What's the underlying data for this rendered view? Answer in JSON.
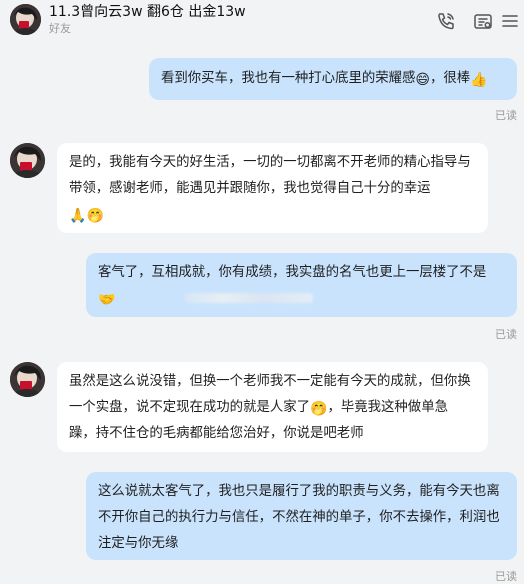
{
  "header": {
    "contact_name": "11.3曾向云3w 翻6仓 出金13w",
    "contact_subtitle": "好友",
    "icons": [
      "phone-icon",
      "video-icon",
      "menu-icon"
    ]
  },
  "messages": [
    {
      "direction": "outgoing",
      "text": "看到你买车，我也有一种打心底里的荣耀感",
      "emoji_1": "😄",
      "text_2": "，很棒",
      "emoji_2": "👍",
      "status": "已读"
    },
    {
      "direction": "incoming",
      "text": "是的，我能有今天的好生活，一切的一切都离不开老师的精心指导与带领，感谢老师，能遇见并跟随你，我也觉得自己十分的幸运",
      "emoji_1": "🙏",
      "emoji_2": "🤭"
    },
    {
      "direction": "outgoing",
      "text": "客气了，互相成就，你有成绩，我实盘的名气也更上一层楼了不是",
      "emoji_1": "🤝",
      "status": "已读"
    },
    {
      "direction": "incoming",
      "text": "虽然是这么说没错，但换一个老师我不一定能有今天的成就，但你换一个实盘，说不定现在成功的就是人家了",
      "emoji_1": "🤭",
      "text_2": "，毕竟我这种做单急躁，持不住仓的毛病都能给您治好，你说是吧老师"
    },
    {
      "direction": "outgoing",
      "text": "这么说就太客气了，我也只是履行了我的职责与义务，能有今天也离不开你自己的执行力与信任，不然在神的单子，你不去操作，利润也注定与你无缘",
      "status": "已读"
    }
  ],
  "colors": {
    "background": "#f2f3f5",
    "outgoing_bubble": "#c9e3fd",
    "incoming_bubble": "#ffffff",
    "read_status": "#999999"
  }
}
